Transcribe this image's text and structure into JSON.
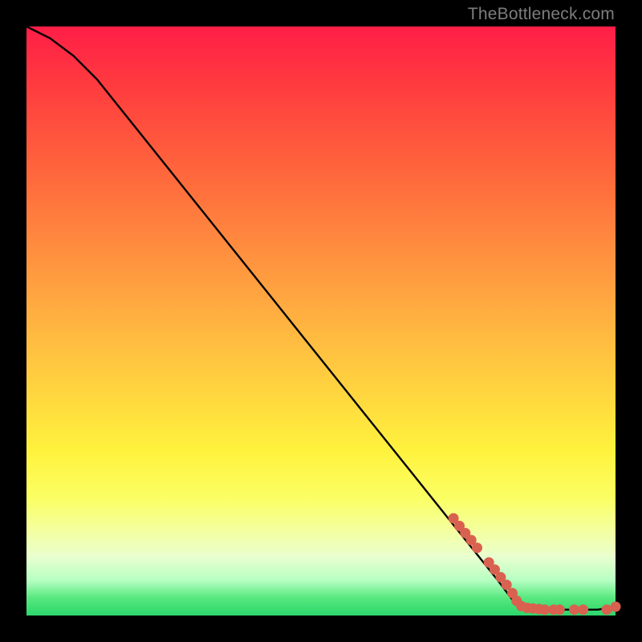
{
  "attribution": "TheBottleneck.com",
  "colors": {
    "line": "#000000",
    "marker_fill": "#d9614f",
    "marker_stroke": "#c44f3f"
  },
  "chart_data": {
    "type": "line",
    "title": "",
    "xlabel": "",
    "ylabel": "",
    "xlim": [
      0,
      100
    ],
    "ylim": [
      0,
      100
    ],
    "series": [
      {
        "name": "curve",
        "x": [
          0,
          4,
          8,
          12,
          16,
          20,
          24,
          28,
          32,
          36,
          40,
          44,
          48,
          52,
          56,
          60,
          64,
          68,
          72,
          76,
          80,
          83,
          85,
          88,
          91,
          94,
          97,
          100
        ],
        "y": [
          100,
          98,
          95,
          91,
          86,
          81,
          76,
          71,
          66,
          61,
          56,
          51,
          46,
          41,
          36,
          31,
          26,
          21,
          16,
          11,
          6,
          2,
          1,
          1,
          1,
          1,
          1,
          1.5
        ]
      }
    ],
    "markers": [
      {
        "x": 72.5,
        "y": 16.5
      },
      {
        "x": 73.5,
        "y": 15.2
      },
      {
        "x": 74.5,
        "y": 14.0
      },
      {
        "x": 75.5,
        "y": 12.8
      },
      {
        "x": 76.5,
        "y": 11.5
      },
      {
        "x": 78.5,
        "y": 9.0
      },
      {
        "x": 79.5,
        "y": 7.8
      },
      {
        "x": 80.5,
        "y": 6.5
      },
      {
        "x": 81.5,
        "y": 5.2
      },
      {
        "x": 82.5,
        "y": 3.8
      },
      {
        "x": 83.2,
        "y": 2.5
      },
      {
        "x": 84.0,
        "y": 1.6
      },
      {
        "x": 85.0,
        "y": 1.3
      },
      {
        "x": 86.0,
        "y": 1.2
      },
      {
        "x": 87.0,
        "y": 1.1
      },
      {
        "x": 88.0,
        "y": 1.0
      },
      {
        "x": 89.5,
        "y": 1.0
      },
      {
        "x": 90.5,
        "y": 1.0
      },
      {
        "x": 93.0,
        "y": 1.0
      },
      {
        "x": 94.5,
        "y": 1.0
      },
      {
        "x": 98.5,
        "y": 1.0
      },
      {
        "x": 100.0,
        "y": 1.5
      }
    ]
  }
}
